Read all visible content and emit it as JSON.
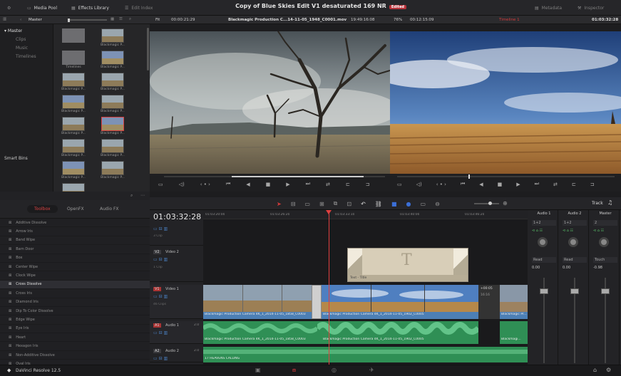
{
  "topbar": {
    "media_pool": "Media Pool",
    "effects_library": "Effects Library",
    "edit_index": "Edit Index",
    "title": "Copy of Blue Skies Edit V1 desaturated 169 NR",
    "edited_badge": "Edited",
    "metadata": "Metadata",
    "inspector": "Inspector"
  },
  "bar2": {
    "bin": "Master",
    "fit": "Fit",
    "source_tc": "00:00:21:29",
    "clip_name": "Blackmagic Production C...14-11-05_1948_C0001.mov",
    "clip_tc": "19:49:16:08",
    "zoom": "76%",
    "dur_tc": "00:12:15:09",
    "timeline_name": "Timeline 1",
    "record_tc": "01:03:32:28"
  },
  "bins": {
    "master": "Master",
    "items": [
      "Clips",
      "Music",
      "Timelines"
    ],
    "smart_bins": "Smart Bins"
  },
  "pool": {
    "clips": [
      {
        "label": "",
        "kind": "folder"
      },
      {
        "label": "Blackmagic P...",
        "kind": "clip"
      },
      {
        "label": "Timelines",
        "kind": "folder-label"
      },
      {
        "label": "Blackmagic P...",
        "kind": "clip"
      },
      {
        "label": "Blackmagic P...",
        "kind": "clip"
      },
      {
        "label": "Blackmagic P...",
        "kind": "clip"
      },
      {
        "label": "Blackmagic P...",
        "kind": "clip"
      },
      {
        "label": "Blackmagic P...",
        "kind": "clip"
      },
      {
        "label": "Blackmagic P...",
        "kind": "clip"
      },
      {
        "label": "Blackmagic P...",
        "kind": "clip"
      },
      {
        "label": "Blackmagic P...",
        "kind": "clip"
      },
      {
        "label": "Blackmagic P...",
        "kind": "clip"
      },
      {
        "label": "Blackmagic P...",
        "kind": "clip"
      },
      {
        "label": "Blackmagic P...",
        "kind": "clip"
      },
      {
        "label": "Blackmagic P...",
        "kind": "clip"
      }
    ]
  },
  "effects": {
    "tabs": [
      "Toolbox",
      "OpenFX",
      "Audio FX"
    ],
    "items": [
      "Additive Dissolve",
      "Arrow Iris",
      "Band Wipe",
      "Barn Door",
      "Box",
      "Center Wipe",
      "Clock Wipe",
      "Cross Dissolve",
      "Cross Iris",
      "Diamond Iris",
      "Dip To Color Dissolve",
      "Edge Wipe",
      "Eye Iris",
      "Heart",
      "Hexagon Iris",
      "Non-Additive Dissolve",
      "Oval Iris"
    ],
    "selected": "Cross Dissolve"
  },
  "timeline": {
    "timecode": "01:03:32:28",
    "ruler": [
      "01:03:20:00",
      "01:03:26:20",
      "01:03:33:10",
      "01:03:40:00",
      "01:03:46:20"
    ],
    "tracks": [
      {
        "id": "V3",
        "name": "",
        "clips": "3 Clip"
      },
      {
        "id": "V2",
        "name": "Video 2",
        "clips": "1 Clip"
      },
      {
        "id": "V1",
        "name": "Video 1",
        "clips": "46 Clips"
      },
      {
        "id": "A1",
        "name": "Audio 1",
        "ch": "2.0"
      },
      {
        "id": "A2",
        "name": "Audio 2",
        "ch": "2.0"
      }
    ],
    "title_clip": "Text - Title",
    "title_glyph": "T",
    "video_clip_1": "Blackmagic Production Camera 4K_1_2014-11-05_1858_C0003",
    "video_clip_2": "Blackmagic Production Camera 4K_1_2014-11-05_1902_C0005",
    "video_clip_3": "Blackmagic Pr...",
    "audio_clip_1": "Blackmagic Production Camera 4K_1_2014-11-05_1858_C0003",
    "audio_clip_2": "Blackmagic Production Camera 4K_1_2014-11-05_1902_C0005",
    "audio_clip_3": "Blackmagi...",
    "audio2_clip": "17 HEAVENS CALLING",
    "trim_tc": "+00:05",
    "trim_tc2": "16:16"
  },
  "mixer": {
    "header": "Track",
    "channels": [
      {
        "name": "Audio 1",
        "route": "1+2",
        "mode": "Read",
        "val": "0.00"
      },
      {
        "name": "Audio 2",
        "route": "1+2",
        "mode": "Read",
        "val": "0.00"
      },
      {
        "name": "Master",
        "route": "2",
        "mode": "Touch",
        "val": "-0.98"
      }
    ]
  },
  "status": {
    "app": "DaVinci Resolve 12.5"
  },
  "colors": {
    "accent_red": "#d03a3a",
    "playhead": "#e04040",
    "video_clip": "#4c7fb5",
    "audio_clip": "#2f8f55",
    "title_clip": "#d8ceb8"
  }
}
